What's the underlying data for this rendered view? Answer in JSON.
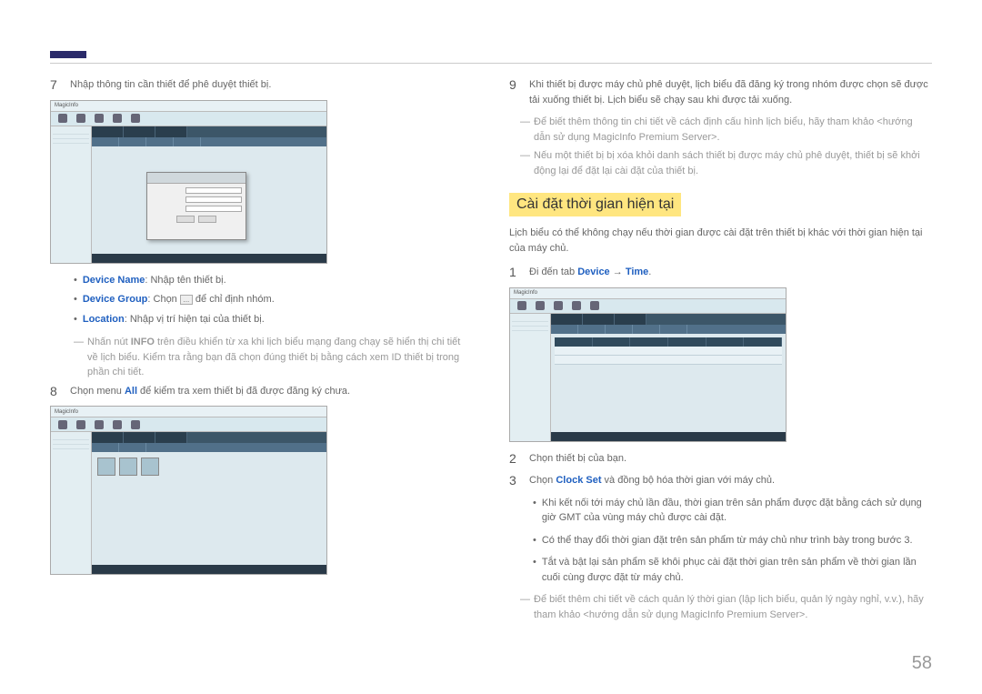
{
  "page_number": "58",
  "left": {
    "step7": {
      "num": "7",
      "text": "Nhập thông tin cần thiết để phê duyệt thiết bị."
    },
    "bullets": {
      "device_name_label": "Device Name",
      "device_name_text": ": Nhập tên thiết bị.",
      "device_group_label": "Device Group",
      "device_group_text_before": ": Chọn ",
      "device_group_text_after": " để chỉ định nhóm.",
      "location_label": "Location",
      "location_text": ": Nhập vị trí hiện tại của thiết bị."
    },
    "note1_prefix": "Nhấn nút ",
    "note1_info": "INFO",
    "note1_rest": " trên điều khiển từ xa khi lịch biểu mạng đang chạy sẽ hiển thị chi tiết về lịch biểu. Kiểm tra rằng bạn đã chọn đúng thiết bị bằng cách xem ID thiết bị trong phần chi tiết.",
    "step8": {
      "num": "8",
      "text_before": "Chọn menu ",
      "all_label": "All",
      "text_after": " để kiểm tra xem thiết bị đã được đăng ký chưa."
    },
    "ss_app": "MagicInfo"
  },
  "right": {
    "step9": {
      "num": "9",
      "text": "Khi thiết bị được máy chủ phê duyệt, lịch biểu đã đăng ký trong nhóm được chọn sẽ được tải xuống thiết bị. Lịch biểu sẽ chạy sau khi được tải xuống."
    },
    "note_a": "Để biết thêm thông tin chi tiết về cách định cấu hình lịch biểu, hãy tham khảo <hướng dẫn sử dụng MagicInfo Premium Server>.",
    "note_b": "Nếu một thiết bị bị xóa khỏi danh sách thiết bị được máy chủ phê duyệt, thiết bị sẽ khởi động lại để đặt lại cài đặt của thiết bị.",
    "section_heading": "Cài đặt thời gian hiện tại",
    "intro": "Lịch biểu có thể không chạy nếu thời gian được cài đặt trên thiết bị khác với thời gian hiện tại của máy chủ.",
    "step1": {
      "num": "1",
      "text_before": "Đi đến tab ",
      "device_label": "Device",
      "arrow": " → ",
      "time_label": "Time",
      "period": "."
    },
    "step2": {
      "num": "2",
      "text": "Chọn thiết bị của bạn."
    },
    "step3": {
      "num": "3",
      "text_before": "Chọn ",
      "clock_set_label": "Clock Set",
      "text_after": " và đồng bộ hóa thời gian với máy chủ."
    },
    "sub_bullets": {
      "b1": "Khi kết nối tới máy chủ lần đầu, thời gian trên sản phẩm được đặt bằng cách sử dụng giờ GMT của vùng máy chủ được cài đặt.",
      "b2": "Có thể thay đổi thời gian đặt trên sản phẩm từ máy chủ như trình bày trong bước 3.",
      "b3": "Tắt và bật lại sản phẩm sẽ khôi phục cài đặt thời gian trên sản phẩm về thời gian lần cuối cùng được đặt từ máy chủ."
    },
    "note_c": "Để biết thêm chi tiết về cách quản lý thời gian (lập lịch biểu, quản lý ngày nghỉ, v.v.), hãy tham khảo <hướng dẫn sử dụng MagicInfo Premium Server>."
  }
}
